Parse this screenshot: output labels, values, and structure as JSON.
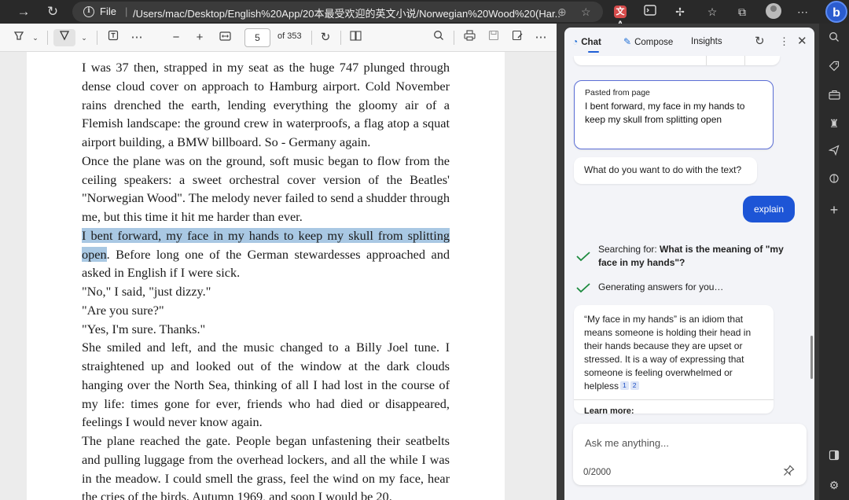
{
  "browser": {
    "scheme": "File",
    "url": "/Users/mac/Desktop/English%20App/20本最受欢迎的英文小说/Norwegian%20Wood%20(Har...",
    "extensions": [
      "translate-icon",
      "terminal-icon",
      "puzzle-icon",
      "favorites-icon",
      "collections-icon",
      "profile-icon",
      "more-icon",
      "bing-icon"
    ],
    "translate_badge": "文A",
    "bing_label": "b"
  },
  "pdf_toolbar": {
    "page_current": "5",
    "page_total": "of 353"
  },
  "pdf": {
    "paragraphs": [
      "I was 37 then, strapped in my seat as the huge 747 plunged through dense cloud cover on approach to Hamburg airport. Cold November rains drenched the earth, lending everything the gloomy air of a Flemish landscape: the ground crew in waterproofs, a flag atop a squat airport building, a BMW billboard. So - Germany again.",
      "Once the plane was on the ground, soft music began to flow from the ceiling speakers: a sweet orchestral cover version of the Beatles' \"Norwegian Wood\". The melody never failed to send a shudder through me, but this time it hit me harder than ever.",
      "HIGHLIGHT",
      "\"No,\" I said, \"just dizzy.\"",
      "\"Are you sure?\"",
      "\"Yes, I'm sure. Thanks.\"",
      "She smiled and left, and the music changed to a Billy Joel tune. I straightened up and looked out of the window at the dark clouds hanging over the North Sea, thinking of all I had lost in the course of my life: times gone for ever, friends who had died or disappeared, feelings I would never know again.",
      "The plane reached the gate. People began unfastening their seatbelts and pulling luggage from the overhead lockers, and all the while I was in the meadow. I could smell the grass, feel the wind on my face, hear the cries of the birds. Autumn 1969, and soon I would be 20."
    ],
    "highlighted": "I bent forward, my face in my hands to keep my skull from splitting open",
    "after_highlight": ". Before long one of the German stewardesses approached and asked in English if I were sick.",
    "highlight_color": "#a9c8e3"
  },
  "sidebar": {
    "tabs": [
      {
        "label": "Chat",
        "icon": "chat-icon"
      },
      {
        "label": "Compose",
        "icon": "compose-icon"
      },
      {
        "label": "Insights",
        "icon": ""
      }
    ],
    "pasted_label": "Pasted from page",
    "pasted_text": "I bent forward, my face in my hands to keep my skull from splitting open",
    "prompt_question": "What do you want to do with the text?",
    "user_message": "explain",
    "search_prefix": "Searching for: ",
    "search_query": "What is the meaning of \"my face in my hands\"?",
    "generating": "Generating answers for you…",
    "answer": "“My face in my hands” is an idiom that means someone is holding their head in their hands because they are upset or stressed. It is a way of expressing that someone is feeling overwhelmed or helpless",
    "citations": [
      "1",
      "2"
    ],
    "learn_more": "Learn more:",
    "input_placeholder": "Ask me anything...",
    "char_count": "0/2000",
    "accent_color": "#1d55d6"
  }
}
